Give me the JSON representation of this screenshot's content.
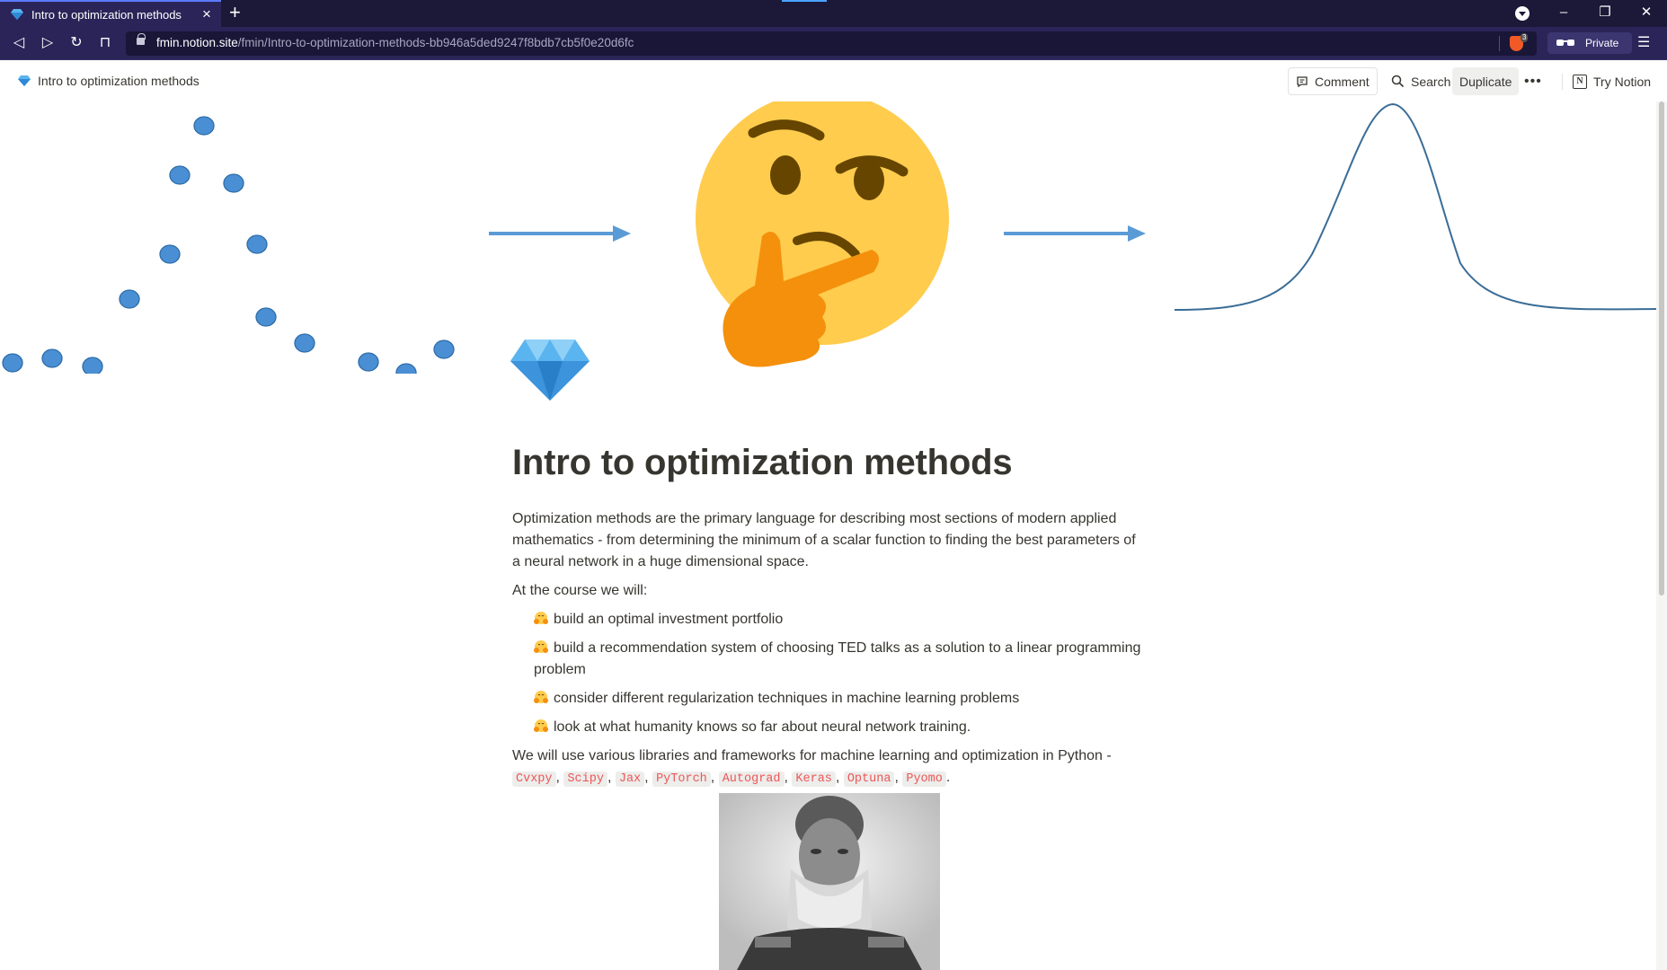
{
  "browser": {
    "tab_title": "Intro to optimization methods",
    "url_host": "fmin.notion.site",
    "url_path": "/fmin/Intro-to-optimization-methods-bb946a5ded9247f8bdb7cb5f0e20d6fc",
    "private_label": "Private",
    "shield_count": "3"
  },
  "topbar": {
    "page_name": "Intro to optimization methods",
    "comment": "Comment",
    "search": "Search",
    "duplicate": "Duplicate",
    "more": "•••",
    "try_notion": "Try Notion"
  },
  "cover": {
    "scatter_color": "#4a8fd4",
    "arrow_color": "#5b9bd5",
    "curve_color": "#3a6c96",
    "center_emoji": "thinking-face"
  },
  "page": {
    "icon": "gem-icon",
    "title": "Intro to optimization methods",
    "intro": "Optimization methods are the primary language for describing most sections of modern applied mathematics - from determining the minimum of a scalar function to finding the best parameters of a neural network in a huge dimensional space.",
    "course_lead": "At the course we will:",
    "bullets": [
      "build an optimal investment portfolio",
      "build a recommendation system of choosing TED talks as a solution to a linear programming problem",
      "consider different regularization techniques in machine learning problems",
      "look at what humanity knows so far about neural network training."
    ],
    "libs_lead": "We will use various libraries and frameworks for machine learning and optimization in Python -",
    "libraries": [
      "Cvxpy",
      "Scipy",
      "Jax",
      "PyTorch",
      "Autograd",
      "Keras",
      "Optuna",
      "Pyomo"
    ],
    "libs_sep": ",",
    "libs_end": ".",
    "image": "bearded-man-portrait"
  }
}
